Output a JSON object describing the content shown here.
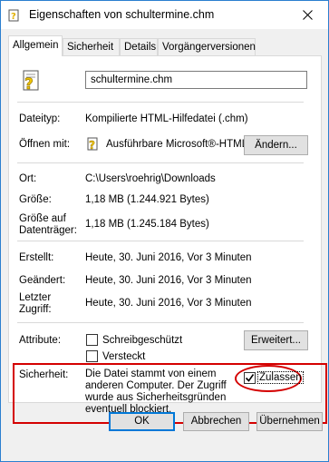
{
  "window": {
    "title": "Eigenschaften von schultermine.chm",
    "close_icon": "close-icon",
    "title_icon": "help-file-icon"
  },
  "tabs": [
    {
      "label": "Allgemein",
      "active": true
    },
    {
      "label": "Sicherheit",
      "active": false
    },
    {
      "label": "Details",
      "active": false
    },
    {
      "label": "Vorgängerversionen",
      "active": false
    }
  ],
  "general": {
    "filename": "schultermine.chm",
    "file_type_label": "Dateityp:",
    "file_type_value": "Kompilierte HTML-Hilfedatei (.chm)",
    "opens_with_label": "Öffnen mit:",
    "opens_with_value": "Ausführbare Microsoft®-HTML",
    "change_button": "Ändern...",
    "location_label": "Ort:",
    "location_value": "C:\\Users\\roehrig\\Downloads",
    "size_label": "Größe:",
    "size_value": "1,18 MB (1.244.921 Bytes)",
    "size_on_disk_label_1": "Größe auf",
    "size_on_disk_label_2": "Datenträger:",
    "size_on_disk_value": "1,18 MB (1.245.184 Bytes)",
    "created_label": "Erstellt:",
    "created_value": "Heute, 30. Juni 2016, Vor 3 Minuten",
    "modified_label": "Geändert:",
    "modified_value": "Heute, 30. Juni 2016, Vor 3 Minuten",
    "accessed_label_1": "Letzter",
    "accessed_label_2": "Zugriff:",
    "accessed_value": "Heute, 30. Juni 2016, Vor 3 Minuten",
    "attributes_label": "Attribute:",
    "readonly_label": "Schreibgeschützt",
    "readonly_checked": false,
    "hidden_label": "Versteckt",
    "hidden_checked": false,
    "advanced_button": "Erweitert...",
    "security_label": "Sicherheit:",
    "security_text": "Die Datei stammt von einem anderen Computer. Der Zugriff wurde aus Sicherheitsgründen eventuell blockiert.",
    "unblock_label": "Zulassen",
    "unblock_checked": true
  },
  "footer": {
    "ok": "OK",
    "cancel": "Abbrechen",
    "apply": "Übernehmen"
  },
  "colors": {
    "accent": "#0078d7",
    "highlight_red": "#d40000",
    "window_border": "#2b7fcf"
  }
}
